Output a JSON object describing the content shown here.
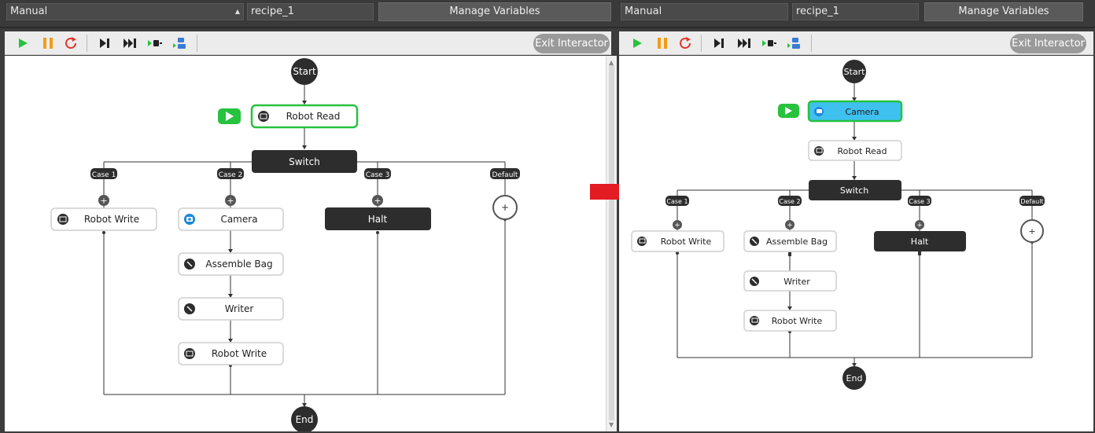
{
  "left": {
    "mode_select": "Manual",
    "recipe_select": "recipe_1",
    "manage_variables": "Manage Variables",
    "exit_interactor": "Exit Interactor",
    "nodes": {
      "start": "Start",
      "robot_read": "Robot Read",
      "switch": "Switch",
      "case1": "Case 1",
      "case2": "Case 2",
      "case3": "Case 3",
      "default": "Default",
      "robot_write_1": "Robot Write",
      "camera": "Camera",
      "assemble_bag": "Assemble Bag",
      "writer": "Writer",
      "robot_write_2": "Robot Write",
      "halt": "Halt",
      "add": "+",
      "end": "End"
    }
  },
  "right": {
    "mode_select": "Manual",
    "recipe_select": "recipe_1",
    "manage_variables": "Manage Variables",
    "exit_interactor": "Exit Interactor",
    "nodes": {
      "start": "Start",
      "camera": "Camera",
      "robot_read": "Robot Read",
      "switch": "Switch",
      "case1": "Case 1",
      "case2": "Case 2",
      "case3": "Case 3",
      "default": "Default",
      "robot_write_1": "Robot Write",
      "assemble_bag": "Assemble Bag",
      "writer": "Writer",
      "robot_write_2": "Robot Write",
      "halt": "Halt",
      "add": "+",
      "end": "End"
    }
  },
  "colors": {
    "play_green": "#27c23e",
    "pause_orange": "#f39c12",
    "restart_red": "#e0352b",
    "active_outline": "#27c23e",
    "camera_active_fill": "#3fc1f0",
    "dark_node": "#2d2d2d",
    "arrow_red": "#e31b23"
  }
}
